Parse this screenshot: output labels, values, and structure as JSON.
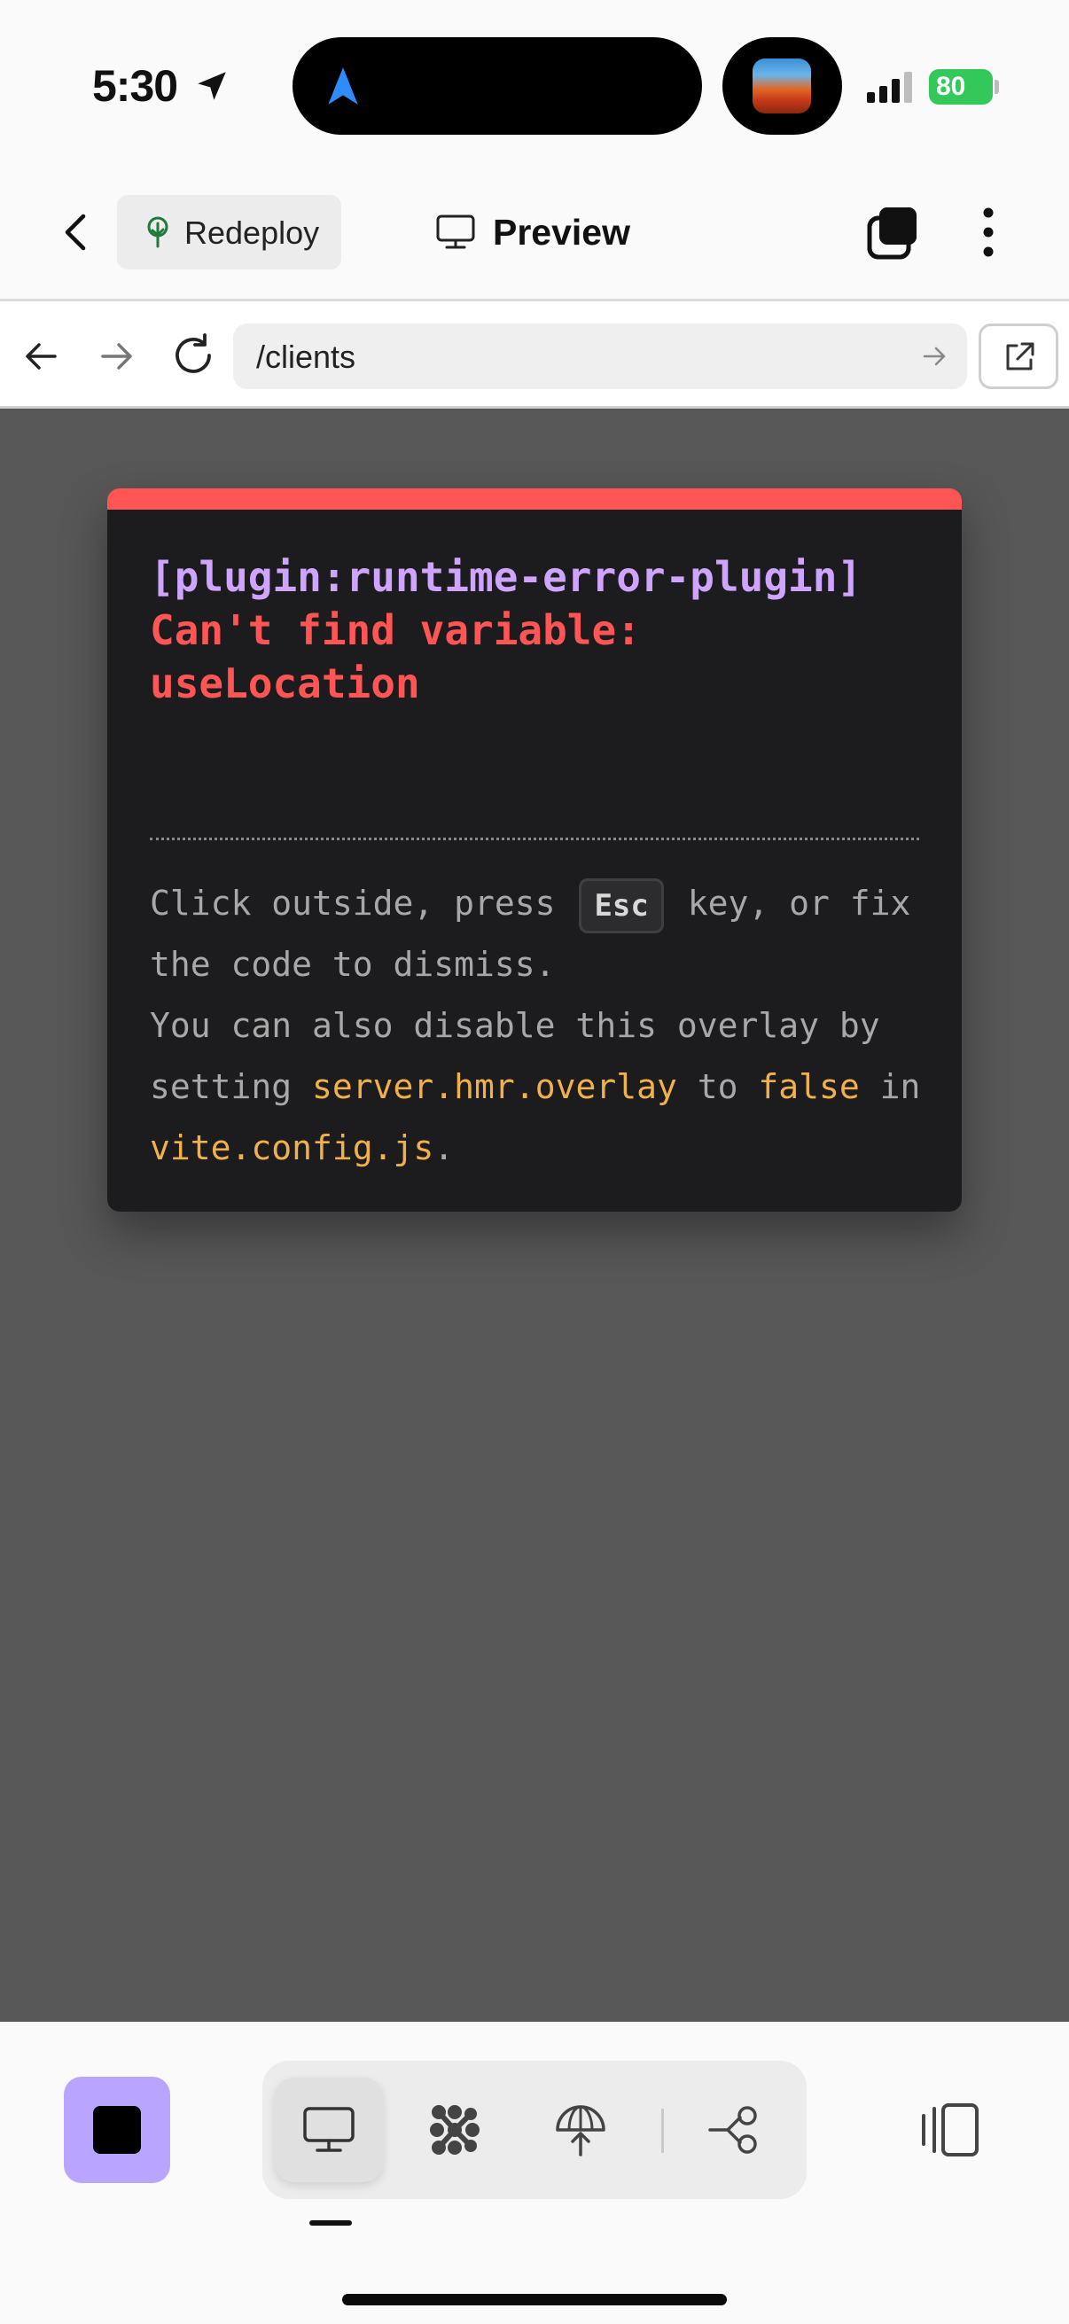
{
  "status_bar": {
    "time": "5:30",
    "battery": "80"
  },
  "header": {
    "redeploy_label": "Redeploy",
    "title": "Preview"
  },
  "address_bar": {
    "url": "/clients"
  },
  "error_overlay": {
    "plugin": "[plugin:runtime-error-plugin]",
    "message": "Can't find variable: useLocation",
    "tip_1": "Click outside, press ",
    "key": "Esc",
    "tip_2": " key, or fix the code to dismiss.",
    "tip_3": "You can also disable this overlay by setting ",
    "setting": "server.hmr.overlay",
    "tip_4": " to ",
    "value": "false",
    "tip_5": " in ",
    "file": "vite.config.js",
    "tip_6": "."
  },
  "colors": {
    "error_red": "#ff5555",
    "plugin_purple": "#cfa4ff",
    "code_orange": "#f0b04a",
    "stop_button": "#b9a4ff",
    "battery_green": "#34c759"
  },
  "icons": {
    "back": "chevron-left-icon",
    "redeploy": "tree-icon",
    "preview": "monitor-icon",
    "tabs": "tabs-icon",
    "more": "vertical-dots-icon",
    "open_external": "external-link-icon",
    "toolbar": [
      "monitor-icon",
      "nodes-icon",
      "deploy-icon",
      "branch-icon"
    ],
    "panel": "panel-icon"
  }
}
